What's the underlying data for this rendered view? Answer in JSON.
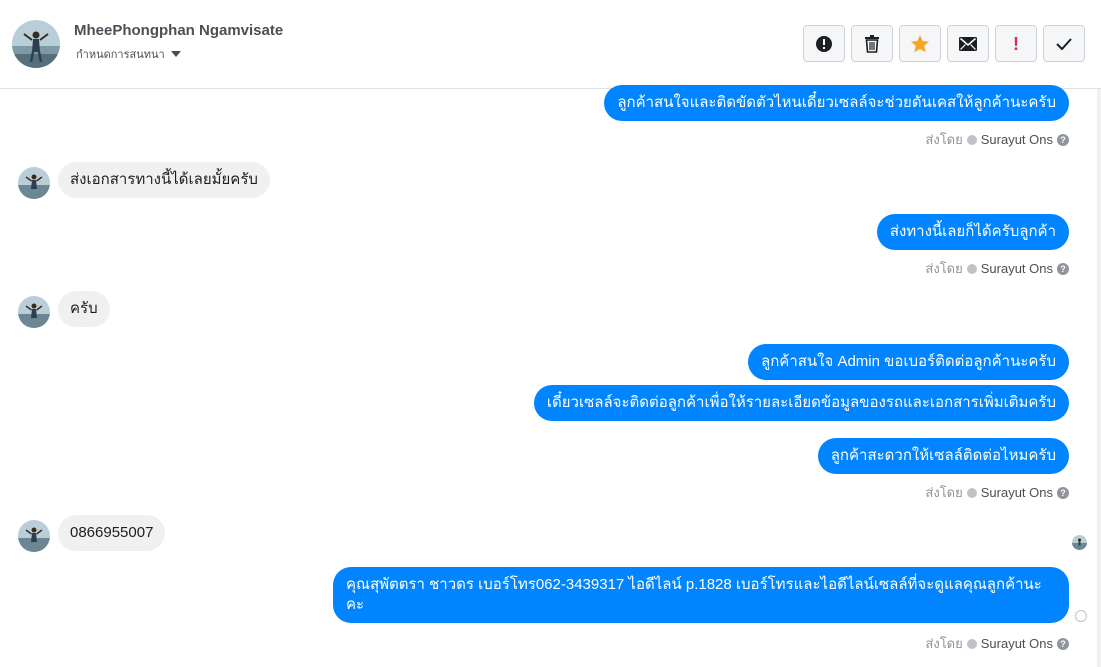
{
  "header": {
    "name": "MheePhongphan Ngamvisate",
    "assign_label": "กำหนดการสนทนา",
    "actions": [
      {
        "icon": "alert-circle-icon",
        "label": "Mark as spam"
      },
      {
        "icon": "trash-icon",
        "label": "Delete"
      },
      {
        "icon": "star-icon",
        "label": "Star"
      },
      {
        "icon": "envelope-icon",
        "label": "Mark unread"
      },
      {
        "icon": "exclamation-icon",
        "label": "Follow up"
      },
      {
        "icon": "check-icon",
        "label": "Done"
      }
    ],
    "accent_orange": "#f5a623"
  },
  "colors": {
    "outgoing": "#0084ff",
    "incoming": "#f1f0f0"
  },
  "thread": {
    "sent_by_label": "ส่งโดย",
    "agent": "Surayut Ons",
    "help_glyph": "?",
    "messages": [
      {
        "dir": "out",
        "text": "ลูกค้าสนใจและติดขัดตัวไหนเดี๋ยวเซลล์จะช่วยดันเคสให้ลูกค้านะครับ"
      },
      {
        "dir": "in",
        "text": "ส่งเอกสารทางนี้ได้เลยมั้ยครับ"
      },
      {
        "dir": "out",
        "text": "ส่งทางนี้เลยก็ได้ครับลูกค้า"
      },
      {
        "dir": "in",
        "text": "ครับ"
      },
      {
        "dir": "out",
        "text": "ลูกค้าสนใจ Admin ขอเบอร์ติดต่อลูกค้านะครับ"
      },
      {
        "dir": "out",
        "text": "เดี๋ยวเซลล์จะติดต่อลูกค้าเพื่อให้รายละเอียดข้อมูลของรถและเอกสารเพิ่มเติมครับ"
      },
      {
        "dir": "out",
        "text": "ลูกค้าสะดวกให้เซลล์ติดต่อไหมครับ"
      },
      {
        "dir": "in",
        "text": "0866955007"
      },
      {
        "dir": "out",
        "text": "คุณสุพัตตรา  ชาวดร เบอร์โทร062-3439317 ไอดีไลน์ p.1828  เบอร์โทรและไอดีไลน์เซลล์ที่จะดูแลคุณลูกค้านะคะ"
      }
    ]
  }
}
